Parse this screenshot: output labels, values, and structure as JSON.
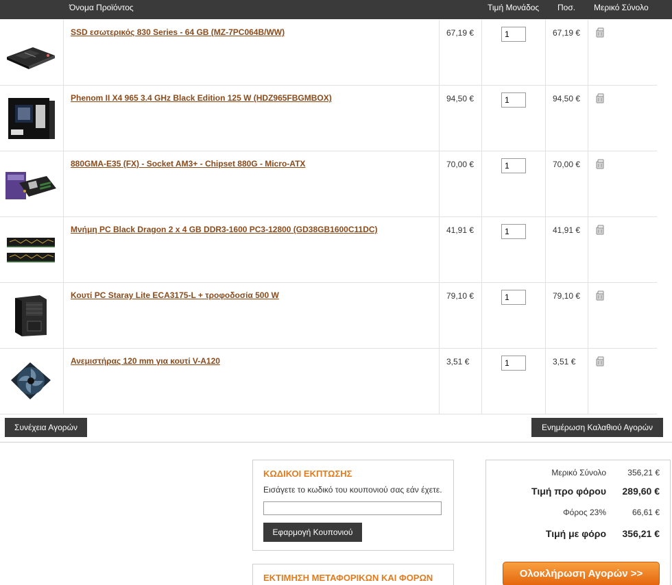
{
  "header": {
    "product_name": "Όνομα Προϊόντος",
    "unit_price": "Τιμή Μονάδος",
    "quantity": "Ποσ.",
    "subtotal": "Μερικό Σύνολο"
  },
  "items": [
    {
      "name": "SSD εσωτερικός 830 Series - 64 GB (MZ-7PC064B/WW)",
      "price": "67,19 €",
      "qty": "1",
      "subtotal": "67,19 €",
      "icon": "ssd-drive-image"
    },
    {
      "name": "Phenom II X4 965 3.4 GHz Black Edition 125 W (HDZ965FBGMBOX)",
      "price": "94,50 €",
      "qty": "1",
      "subtotal": "94,50 €",
      "icon": "cpu-box-image"
    },
    {
      "name": "880GMA-E35 (FX) - Socket AM3+ - Chipset 880G - Micro-ATX",
      "price": "70,00 €",
      "qty": "1",
      "subtotal": "70,00 €",
      "icon": "motherboard-image"
    },
    {
      "name": "Μνήμη PC Black Dragon 2 x 4 GB DDR3-1600 PC3-12800 (GD38GB1600C11DC)",
      "price": "41,91 €",
      "qty": "1",
      "subtotal": "41,91 €",
      "icon": "ram-module-image"
    },
    {
      "name": "Κουτί PC Staray Lite ECA3175-L + τροφοδοσία 500 W",
      "price": "79,10 €",
      "qty": "1",
      "subtotal": "79,10 €",
      "icon": "pc-case-image"
    },
    {
      "name": "Ανεμιστήρας 120 mm για κουτί V-A120",
      "price": "3,51 €",
      "qty": "1",
      "subtotal": "3,51 €",
      "icon": "case-fan-image"
    }
  ],
  "buttons": {
    "continue_shopping": "Συνέχεια Αγορών",
    "update_cart": "Ενημέρωση Καλαθιού Αγορών",
    "apply_coupon": "Εφαρμογή Κουπονιού",
    "checkout": "Ολοκλήρωση Αγορών >>"
  },
  "coupon": {
    "title": "ΚΩΔΙΚΟΙ ΕΚΠΤΩΣΗΣ",
    "text": "Εισάγετε το κωδικό του κουπονιού σας εάν έχετε.",
    "value": ""
  },
  "shipping": {
    "title": "ΕΚΤΙΜΗΣΗ ΜΕΤΑΦΟΡΙΚΩΝ ΚΑΙ ΦΟΡΩΝ"
  },
  "totals": {
    "subtotal_label": "Μερικό Σύνολο",
    "subtotal_value": "356,21 €",
    "pretax_label": "Τιμή προ φόρου",
    "pretax_value": "289,60 €",
    "tax_label": "Φόρος 23%",
    "tax_value": "66,61 €",
    "total_label": "Τιμή με φόρο",
    "total_value": "356,21 €"
  },
  "colors": {
    "header_bg": "#3a3a3a",
    "link": "#8a4a1a",
    "accent": "#e07b1e"
  }
}
